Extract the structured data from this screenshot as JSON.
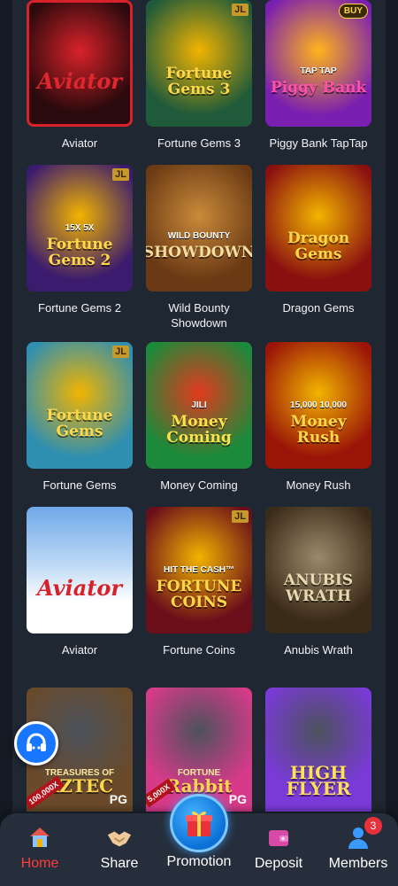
{
  "games": [
    {
      "name": "Aviator",
      "art_text": "Aviator",
      "art_subtext": "",
      "badge": "",
      "bg": "#2a0a0c",
      "accent": "#d8222a",
      "text_color": "#e0262e"
    },
    {
      "name": "Fortune Gems 3",
      "art_text": "Fortune Gems 3",
      "art_subtext": "",
      "badge": "JL",
      "bg": "#1f5a3a",
      "accent": "#f2b400",
      "text_color": "#ffd84a"
    },
    {
      "name": "Piggy Bank TapTap",
      "art_text": "Piggy Bank",
      "art_subtext": "TAP TAP",
      "badge": "BUY",
      "bg": "#7a1fb0",
      "accent": "#ffb41a",
      "text_color": "#ff4fa8"
    },
    {
      "name": "Fortune Gems 2",
      "art_text": "Fortune Gems 2",
      "art_subtext": "15X 5X",
      "badge": "JL",
      "bg": "#3b1b6e",
      "accent": "#f2b400",
      "text_color": "#ffd84a"
    },
    {
      "name": "Wild Bounty Showdown",
      "art_text": "SHOWDOWN",
      "art_subtext": "WILD BOUNTY",
      "badge": "",
      "bg": "#6b3a14",
      "accent": "#c98a3a",
      "text_color": "#f5dca0"
    },
    {
      "name": "Dragon Gems",
      "art_text": "Dragon Gems",
      "art_subtext": "",
      "badge": "",
      "bg": "#8a1010",
      "accent": "#f2b400",
      "text_color": "#ffd84a"
    },
    {
      "name": "Fortune Gems",
      "art_text": "Fortune Gems",
      "art_subtext": "",
      "badge": "JL",
      "bg": "#2f8fb0",
      "accent": "#f2b400",
      "text_color": "#ffd84a"
    },
    {
      "name": "Money Coming",
      "art_text": "Money Coming",
      "art_subtext": "JILI",
      "badge": "",
      "bg": "#1b8a3a",
      "accent": "#e23a1e",
      "text_color": "#ffe24a"
    },
    {
      "name": "Money Rush",
      "art_text": "Money Rush",
      "art_subtext": "15,000  10,000",
      "badge": "",
      "bg": "#9a1408",
      "accent": "#f2b400",
      "text_color": "#ffd84a"
    },
    {
      "name": "Aviator",
      "art_text": "Aviator",
      "art_subtext": "",
      "badge": "",
      "bg": "#f2f4f6",
      "accent": "#d8222a",
      "text_color": "#d8222a"
    },
    {
      "name": "Fortune Coins",
      "art_text": "FORTUNE COINS",
      "art_subtext": "HIT THE CASH™",
      "badge": "JL",
      "bg": "#6a0f1a",
      "accent": "#f2b400",
      "text_color": "#ffd84a"
    },
    {
      "name": "Anubis Wrath",
      "art_text": "ANUBIS WRATH",
      "art_subtext": "",
      "badge": "",
      "bg": "#3a2a18",
      "accent": "#9a8a6a",
      "text_color": "#e8d9b0"
    }
  ],
  "partial_games": [
    {
      "art_text": "AZTEC",
      "art_subtext": "TREASURES OF",
      "corner": "PG",
      "ribbon": "100,000X",
      "bg": "#6a4a2a",
      "text_color": "#ffd84a"
    },
    {
      "art_text": "Rabbit",
      "art_subtext": "FORTUNE",
      "corner": "PG",
      "ribbon": "5,000X",
      "bg": "#d83a8a",
      "text_color": "#ffd84a"
    },
    {
      "art_text": "HIGH FLYER",
      "art_subtext": "",
      "corner": "",
      "ribbon": "",
      "bg": "#7a3ad8",
      "text_color": "#ffe05a"
    }
  ],
  "nav": {
    "home": "Home",
    "share": "Share",
    "promotion": "Promotion",
    "deposit": "Deposit",
    "members": "Members",
    "members_badge": "3"
  },
  "icons": {
    "support": "headset-icon",
    "home": "home-icon",
    "share": "handshake-icon",
    "promotion": "gift-icon",
    "deposit": "wallet-icon",
    "members": "user-icon"
  },
  "colors": {
    "page_bg": "#1f2733",
    "nav_bg": "#262e3c",
    "active": "#ff3b3b",
    "promo_blue": "#0b6fd6"
  }
}
